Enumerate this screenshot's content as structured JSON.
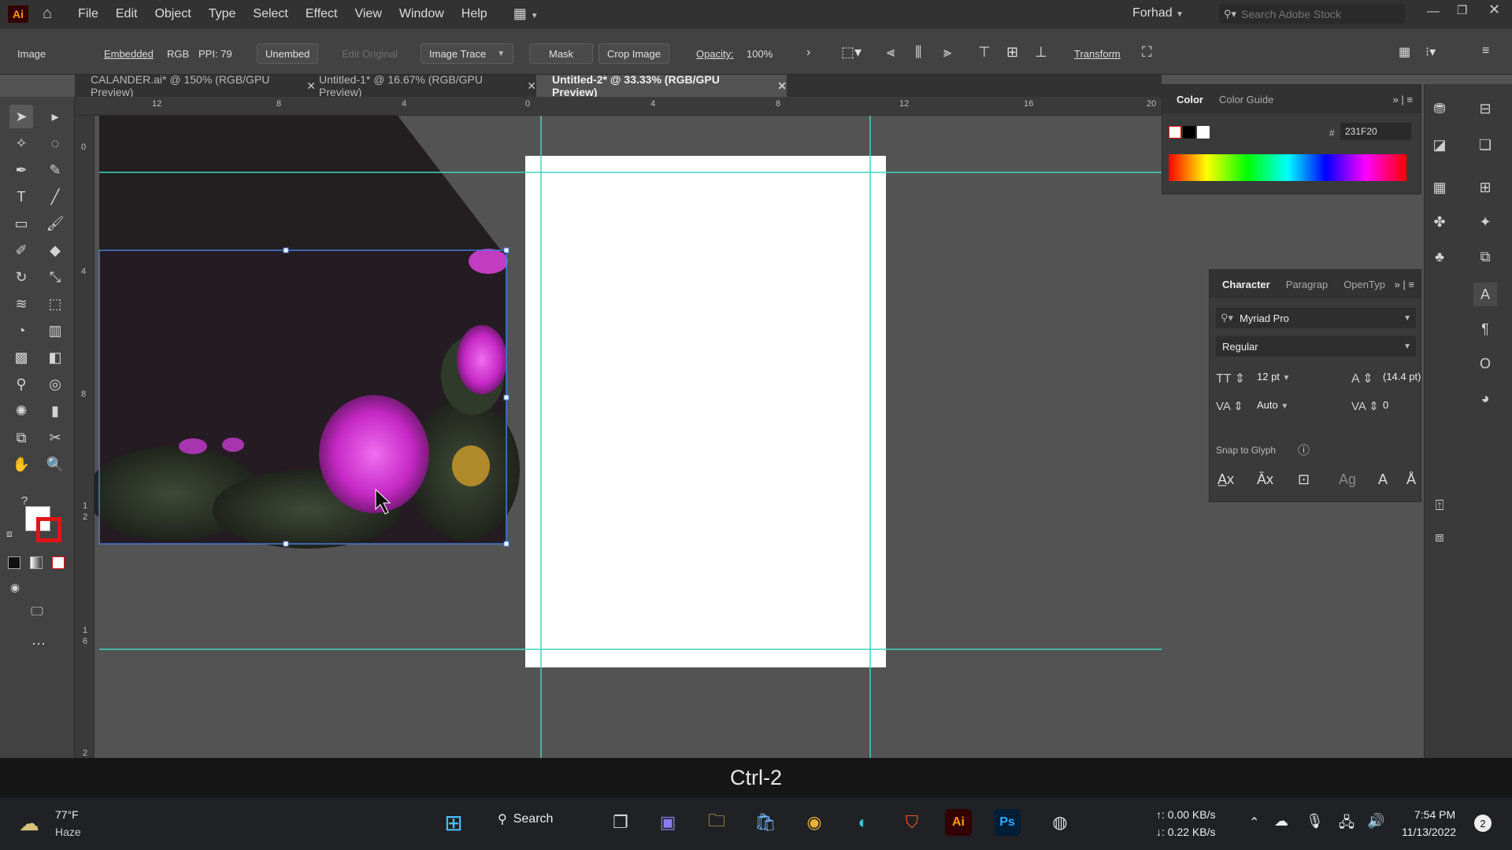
{
  "menubar": {
    "logo": "Ai",
    "items": [
      "File",
      "Edit",
      "Object",
      "Type",
      "Select",
      "Effect",
      "View",
      "Window",
      "Help"
    ],
    "workspace": "Forhad",
    "search_placeholder": "Search Adobe Stock"
  },
  "controlbar": {
    "object_type": "Image",
    "embedded": "Embedded",
    "color_mode": "RGB",
    "ppi": "PPI: 79",
    "unembed": "Unembed",
    "edit_original": "Edit Original",
    "image_trace": "Image Trace",
    "mask": "Mask",
    "crop_image": "Crop Image",
    "opacity_label": "Opacity:",
    "opacity_value": "100%",
    "transform": "Transform"
  },
  "tabs": [
    {
      "label": "CALANDER.ai* @ 150% (RGB/GPU Preview)",
      "active": false
    },
    {
      "label": "Untitled-1* @ 16.67% (RGB/GPU Preview)",
      "active": false
    },
    {
      "label": "Untitled-2* @ 33.33% (RGB/GPU Preview)",
      "active": true
    }
  ],
  "ruler": {
    "top": [
      "12",
      "8",
      "4",
      "0",
      "4",
      "8",
      "12",
      "16",
      "20"
    ],
    "left": [
      "0",
      "4",
      "8",
      "1",
      "2",
      "1",
      "6",
      "2"
    ]
  },
  "color_panel": {
    "tabs": [
      "Color",
      "Color Guide"
    ],
    "hex_label": "#",
    "hex": "231F20"
  },
  "character_panel": {
    "tabs": [
      "Character",
      "Paragrap",
      "OpenTyp"
    ],
    "font_family": "Myriad Pro",
    "font_style": "Regular",
    "font_size": "12 pt",
    "leading": "(14.4 pt)",
    "kerning": "Auto",
    "tracking": "0",
    "snap_to_glyph": "Snap to Glyph"
  },
  "shortcut_overlay": "Ctrl-2",
  "taskbar": {
    "weather_temp": "77°F",
    "weather_desc": "Haze",
    "search_label": "Search",
    "net_up": "↑: 0.00 KB/s",
    "net_down": "↓: 0.22 KB/s",
    "time": "7:54 PM",
    "date": "11/13/2022",
    "notification_count": "2"
  }
}
